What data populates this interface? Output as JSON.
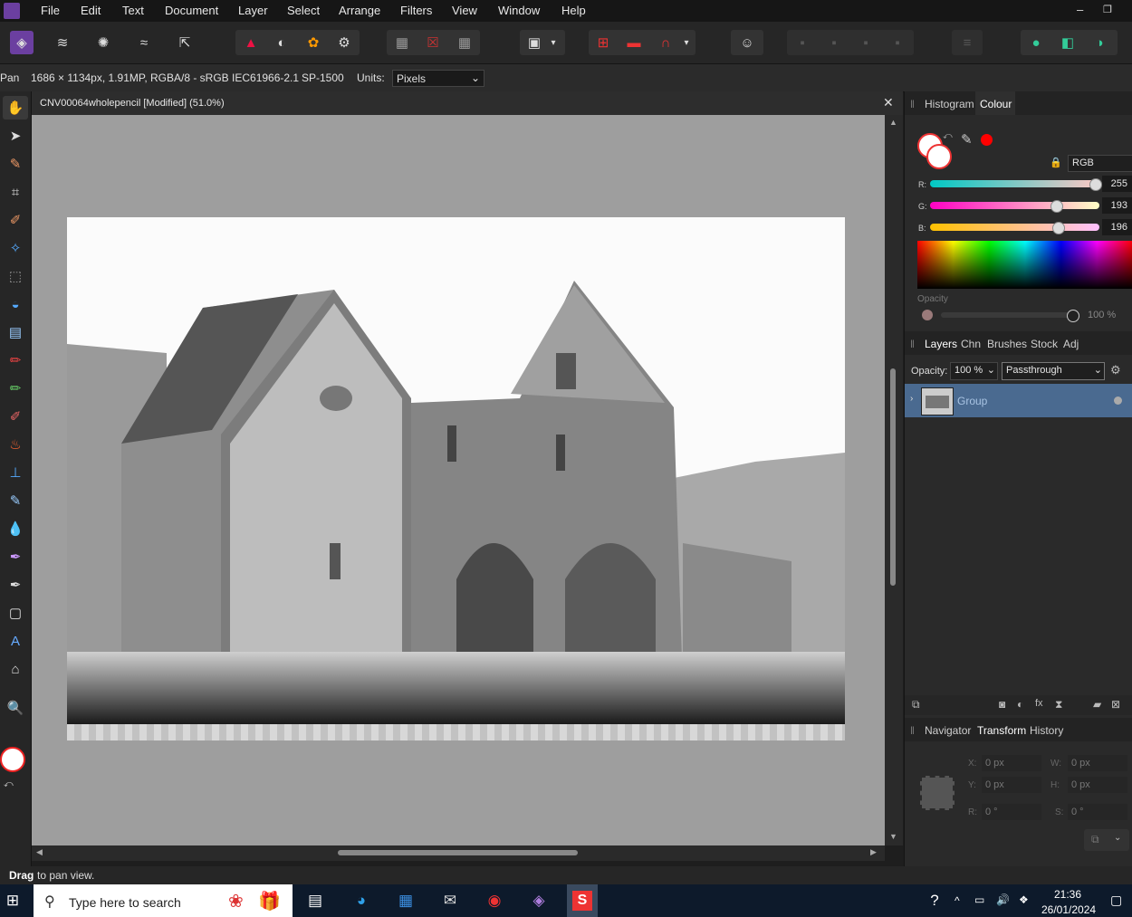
{
  "menubar": {
    "items": [
      "File",
      "Edit",
      "Text",
      "Document",
      "Layer",
      "Select",
      "Arrange",
      "Filters",
      "View",
      "Window",
      "Help"
    ]
  },
  "contextbar": {
    "tool": "Pan",
    "doc_info": "1686 × 1134px, 1.91MP, RGBA/8 - sRGB IEC61966-2.1",
    "profile": "SP-1500",
    "units_label": "Units:",
    "units_value": "Pixels"
  },
  "document": {
    "tab_title": "CNV00064wholepencil [Modified] (51.0%)"
  },
  "colour_panel": {
    "tabs": [
      "Histogram",
      "Colour"
    ],
    "model": "RGB",
    "channels": [
      {
        "label": "R:",
        "value": "255",
        "fraction": 1.0
      },
      {
        "label": "G:",
        "value": "193",
        "fraction": 0.757
      },
      {
        "label": "B:",
        "value": "196",
        "fraction": 0.769
      }
    ],
    "opacity_label": "Opacity",
    "opacity_value": "100 %"
  },
  "layers_panel": {
    "tabs": [
      "Layers",
      "Chn",
      "Brushes",
      "Stock",
      "Adj"
    ],
    "opacity_label": "Opacity:",
    "opacity_value": "100 %",
    "blend_mode": "Passthrough",
    "layers": [
      {
        "name": "Group"
      }
    ]
  },
  "transform_panel": {
    "tabs": [
      "Navigator",
      "Transform",
      "History"
    ],
    "fields": {
      "x_label": "X:",
      "x": "0 px",
      "y_label": "Y:",
      "y": "0 px",
      "w_label": "W:",
      "w": "0 px",
      "h_label": "H:",
      "h": "0 px",
      "r_label": "R:",
      "r": "0 °",
      "s_label": "S:",
      "s": "0 °"
    }
  },
  "statusbar": {
    "bold": "Drag",
    "text": "to pan view."
  },
  "taskbar": {
    "search_placeholder": "Type here to search",
    "time": "21:36",
    "date": "26/01/2024"
  },
  "colors": {
    "accent": "#4a6a90",
    "primary_swatch": "#ff0000"
  }
}
